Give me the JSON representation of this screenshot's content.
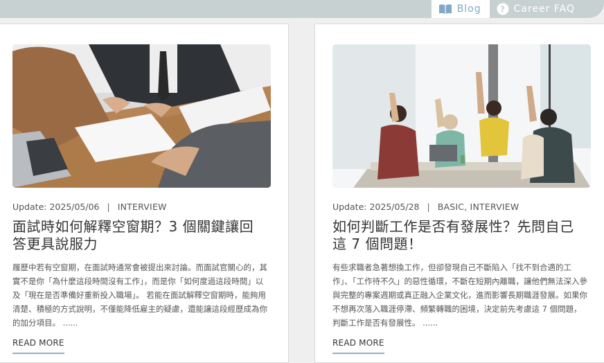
{
  "nav": {
    "blog_label": "Blog",
    "blog_icon": "book-open-icon",
    "faq_label": "Career FAQ",
    "faq_icon": "question-circle-icon"
  },
  "articles": [
    {
      "date": "Update: 2025/05/06",
      "separator": "|",
      "categories": "INTERVIEW",
      "title": "面試時如何解釋空窗期？3 個關鍵讓回答更具說服力",
      "excerpt": "履歷中若有空窗期，在面試時通常會被提出來討論。而面試官關心的，其實不是你「為什麼這段時間沒有工作」，而是你「如何度過這段時間」以及「現在是否準備好重新投入職場」。 若能在面試解釋空窗期時，能夠用清楚、積極的方式說明，不僅能降低雇主的疑慮，還能讓這段經歷成為你的加分項目。 ......",
      "read_more": "READ MORE",
      "image": "interview-meeting-photo"
    },
    {
      "date": "Update: 2025/05/28",
      "separator": "|",
      "categories": "BASIC, INTERVIEW",
      "title": "如何判斷工作是否有發展性？先問自己這 7 個問題！",
      "excerpt": "有些求職者急著想換工作，但卻發現自己不斷陷入「找不到合適的工作」、「工作待不久」的惡性循環，不斷在短期內離職，讓他們無法深入參與完整的專案週期或真正融入企業文化，進而影響長期職涯發展。如果你不想再次落入職涯停滯、頻繁轉職的困境，決定前先考慮這 7 個問題，判斷工作是否有發展性。 ......",
      "read_more": "READ MORE",
      "image": "team-celebration-photo"
    }
  ]
}
